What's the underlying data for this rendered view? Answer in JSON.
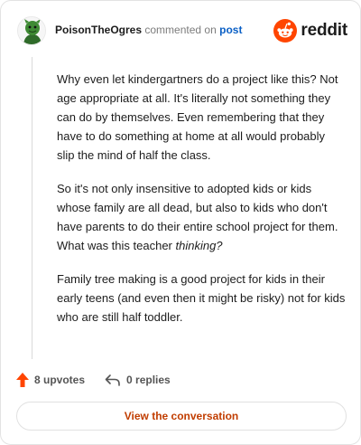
{
  "comment": {
    "username": "PoisonTheOgres",
    "action_text": "commented on",
    "post_link": "post"
  },
  "brand": {
    "name": "reddit",
    "icon": "reddit-logo-icon",
    "color": "#ff4500"
  },
  "body": {
    "p1": "Why even let kindergartners do a project like this? Not age appropriate at all. It's literally not something they can do by themselves. Even remembering that they have to do something at home at all would probably slip the mind of half the class.",
    "p2_start": "So it's not only insensitive to adopted kids or kids whose family are all dead, but also to kids who don't have parents to do their entire school project for them. What was this teacher ",
    "p2_emphasis": "thinking?",
    "p3": "Family tree making is a good project for kids in their early teens (and even then it might be risky) not for kids who are still half toddler."
  },
  "footer": {
    "upvotes": "8 upvotes",
    "replies": "0 replies",
    "upvote_icon": "upvote-arrow-icon",
    "reply_icon": "reply-arrow-icon",
    "upvote_color": "#ff4500"
  },
  "cta": {
    "label": "View the conversation"
  }
}
